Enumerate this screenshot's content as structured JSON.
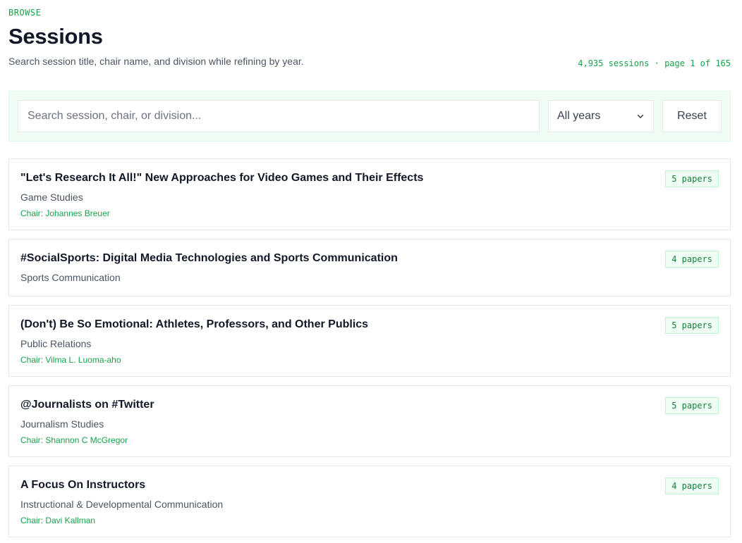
{
  "header": {
    "eyebrow": "BROWSE",
    "title": "Sessions",
    "subtitle": "Search session title, chair name, and division while refining by year.",
    "count": "4,935 sessions · page 1 of 165"
  },
  "filters": {
    "search_placeholder": "Search session, chair, or division...",
    "search_value": "",
    "year_selected": "All years",
    "reset_label": "Reset"
  },
  "sessions": [
    {
      "title": "\"Let's Research It All!\" New Approaches for Video Games and Their Effects",
      "division": "Game Studies",
      "chair": "Chair: Johannes Breuer",
      "papers": "5 papers"
    },
    {
      "title": "#SocialSports: Digital Media Technologies and Sports Communication",
      "division": "Sports Communication",
      "chair": "",
      "papers": "4 papers"
    },
    {
      "title": "(Don't) Be So Emotional: Athletes, Professors, and Other Publics",
      "division": "Public Relations",
      "chair": "Chair: Vilma L. Luoma-aho",
      "papers": "5 papers"
    },
    {
      "title": "@Journalists on #Twitter",
      "division": "Journalism Studies",
      "chair": "Chair: Shannon C McGregor",
      "papers": "5 papers"
    },
    {
      "title": "A Focus On Instructors",
      "division": "Instructional & Developmental Communication",
      "chair": "Chair: Davi Kallman",
      "papers": "4 papers"
    }
  ],
  "colors": {
    "accent": "#16a34a",
    "panel_bg": "#f0fdf4",
    "border": "#e5e7eb"
  }
}
